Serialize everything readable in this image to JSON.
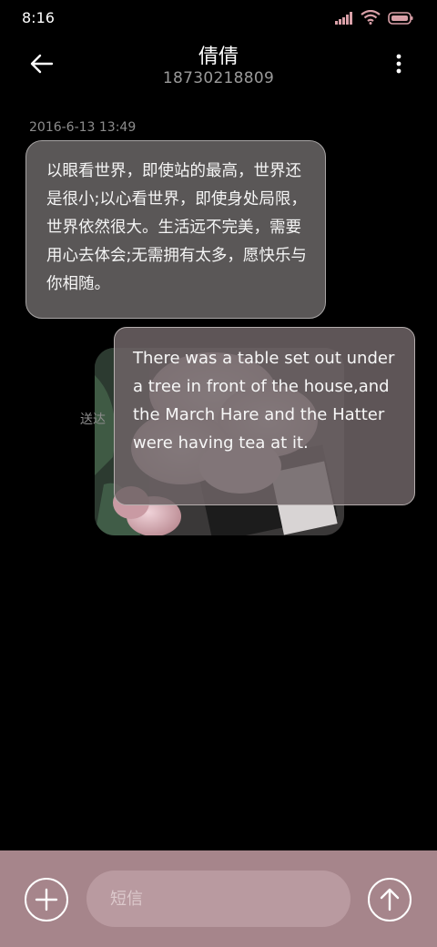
{
  "status_bar": {
    "time": "8:16",
    "icons": [
      "signal-icon",
      "wifi-icon",
      "battery-icon"
    ]
  },
  "header": {
    "back_icon": "arrow-left-icon",
    "contact_name": "倩倩",
    "phone_number": "18730218809",
    "more_icon": "more-vertical-icon"
  },
  "conversation": {
    "timestamp": "2016-6-13 13:49",
    "incoming": {
      "text": "以眼看世界，即使站的最高，世界还是很小;以心看世界，即使身处局限，世界依然很大。生活远不完美，需要用心去体会;无需拥有太多，愿快乐与你相随。"
    },
    "outgoing": {
      "status": "送达",
      "text": "There was a table set out under a tree in front of the house,and the March Hare and the Hatter were having tea at it."
    }
  },
  "input_bar": {
    "add_icon": "plus-icon",
    "placeholder": "短信",
    "value": "",
    "send_icon": "arrow-up-icon"
  },
  "colors": {
    "background": "#000000",
    "input_bar": "#a6858b",
    "input_field": "#b99aa0",
    "incoming_bubble": "#5a5757",
    "outgoing_bubble": "#6e6466"
  }
}
